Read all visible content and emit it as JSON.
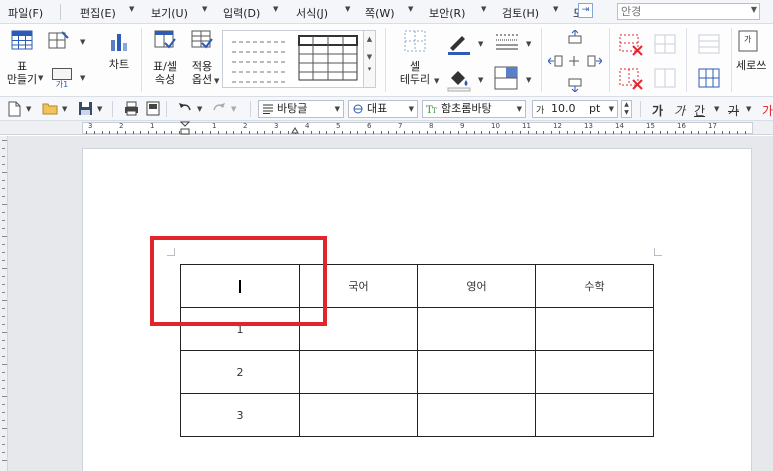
{
  "menu": {
    "items": [
      "파일(F)",
      "편집(E)",
      "보기(U)",
      "입력(D)",
      "서식(J)",
      "쪽(W)",
      "보안(R)",
      "검토(H)",
      "도"
    ],
    "search_placeholder": "안경"
  },
  "ribbon": {
    "table_make": [
      "표",
      "만들기"
    ],
    "chart": "차트",
    "table_props": [
      "표/셀",
      "속성"
    ],
    "apply_options": [
      "적용",
      "옵션"
    ],
    "cell_border": [
      "셀",
      "테두리"
    ],
    "vertical_write": "세로쓰",
    "char_tag": "가1"
  },
  "toolbar": {
    "style": "바탕글",
    "font_lang": "대표",
    "font": "함초롬바탕",
    "size": "10.0",
    "unit": "pt",
    "format_labels": [
      "가",
      "가",
      "간",
      "가",
      "가"
    ]
  },
  "ruler": {
    "numbers": [
      "3",
      "2",
      "1",
      "1",
      "2",
      "3",
      "4",
      "5",
      "6",
      "7",
      "8",
      "9",
      "10",
      "11",
      "12",
      "13",
      "14",
      "15",
      "16",
      "17"
    ]
  },
  "table": {
    "header": [
      "",
      "국어",
      "영어",
      "수학"
    ],
    "rows": [
      [
        "1",
        "",
        "",
        ""
      ],
      [
        "2",
        "",
        "",
        ""
      ],
      [
        "3",
        "",
        "",
        ""
      ]
    ]
  },
  "colors": {
    "highlight": "#e0262c",
    "accent": "#2d5cb8"
  }
}
